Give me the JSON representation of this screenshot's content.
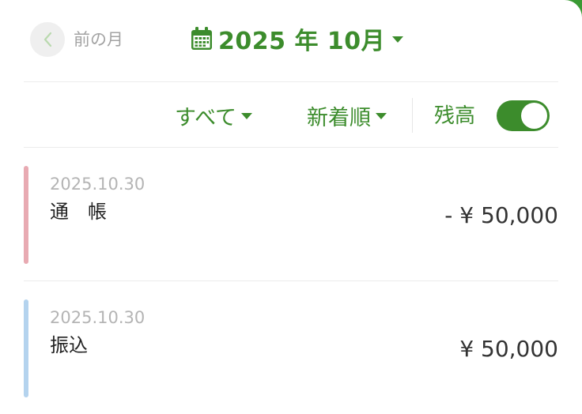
{
  "header": {
    "prev_label": "前の月",
    "month_label": "2025 年 10月",
    "icons": {
      "prev": "chevron-left-icon",
      "calendar": "calendar-icon",
      "dropdown": "caret-down-icon"
    }
  },
  "filters": {
    "category": "すべて",
    "sort": "新着順",
    "balance_label": "残高",
    "balance_toggle_on": true
  },
  "transactions": [
    {
      "date": "2025.10.30",
      "title": "通　帳",
      "amount": "- ¥ 50,000",
      "accent_color": "#e8aab2"
    },
    {
      "date": "2025.10.30",
      "title": "振込",
      "amount": "¥ 50,000",
      "accent_color": "#b4d3ee"
    }
  ],
  "colors": {
    "primary_green": "#3c8c2c",
    "background_green": "#3a9a34",
    "muted_text": "#a3a3a3"
  }
}
